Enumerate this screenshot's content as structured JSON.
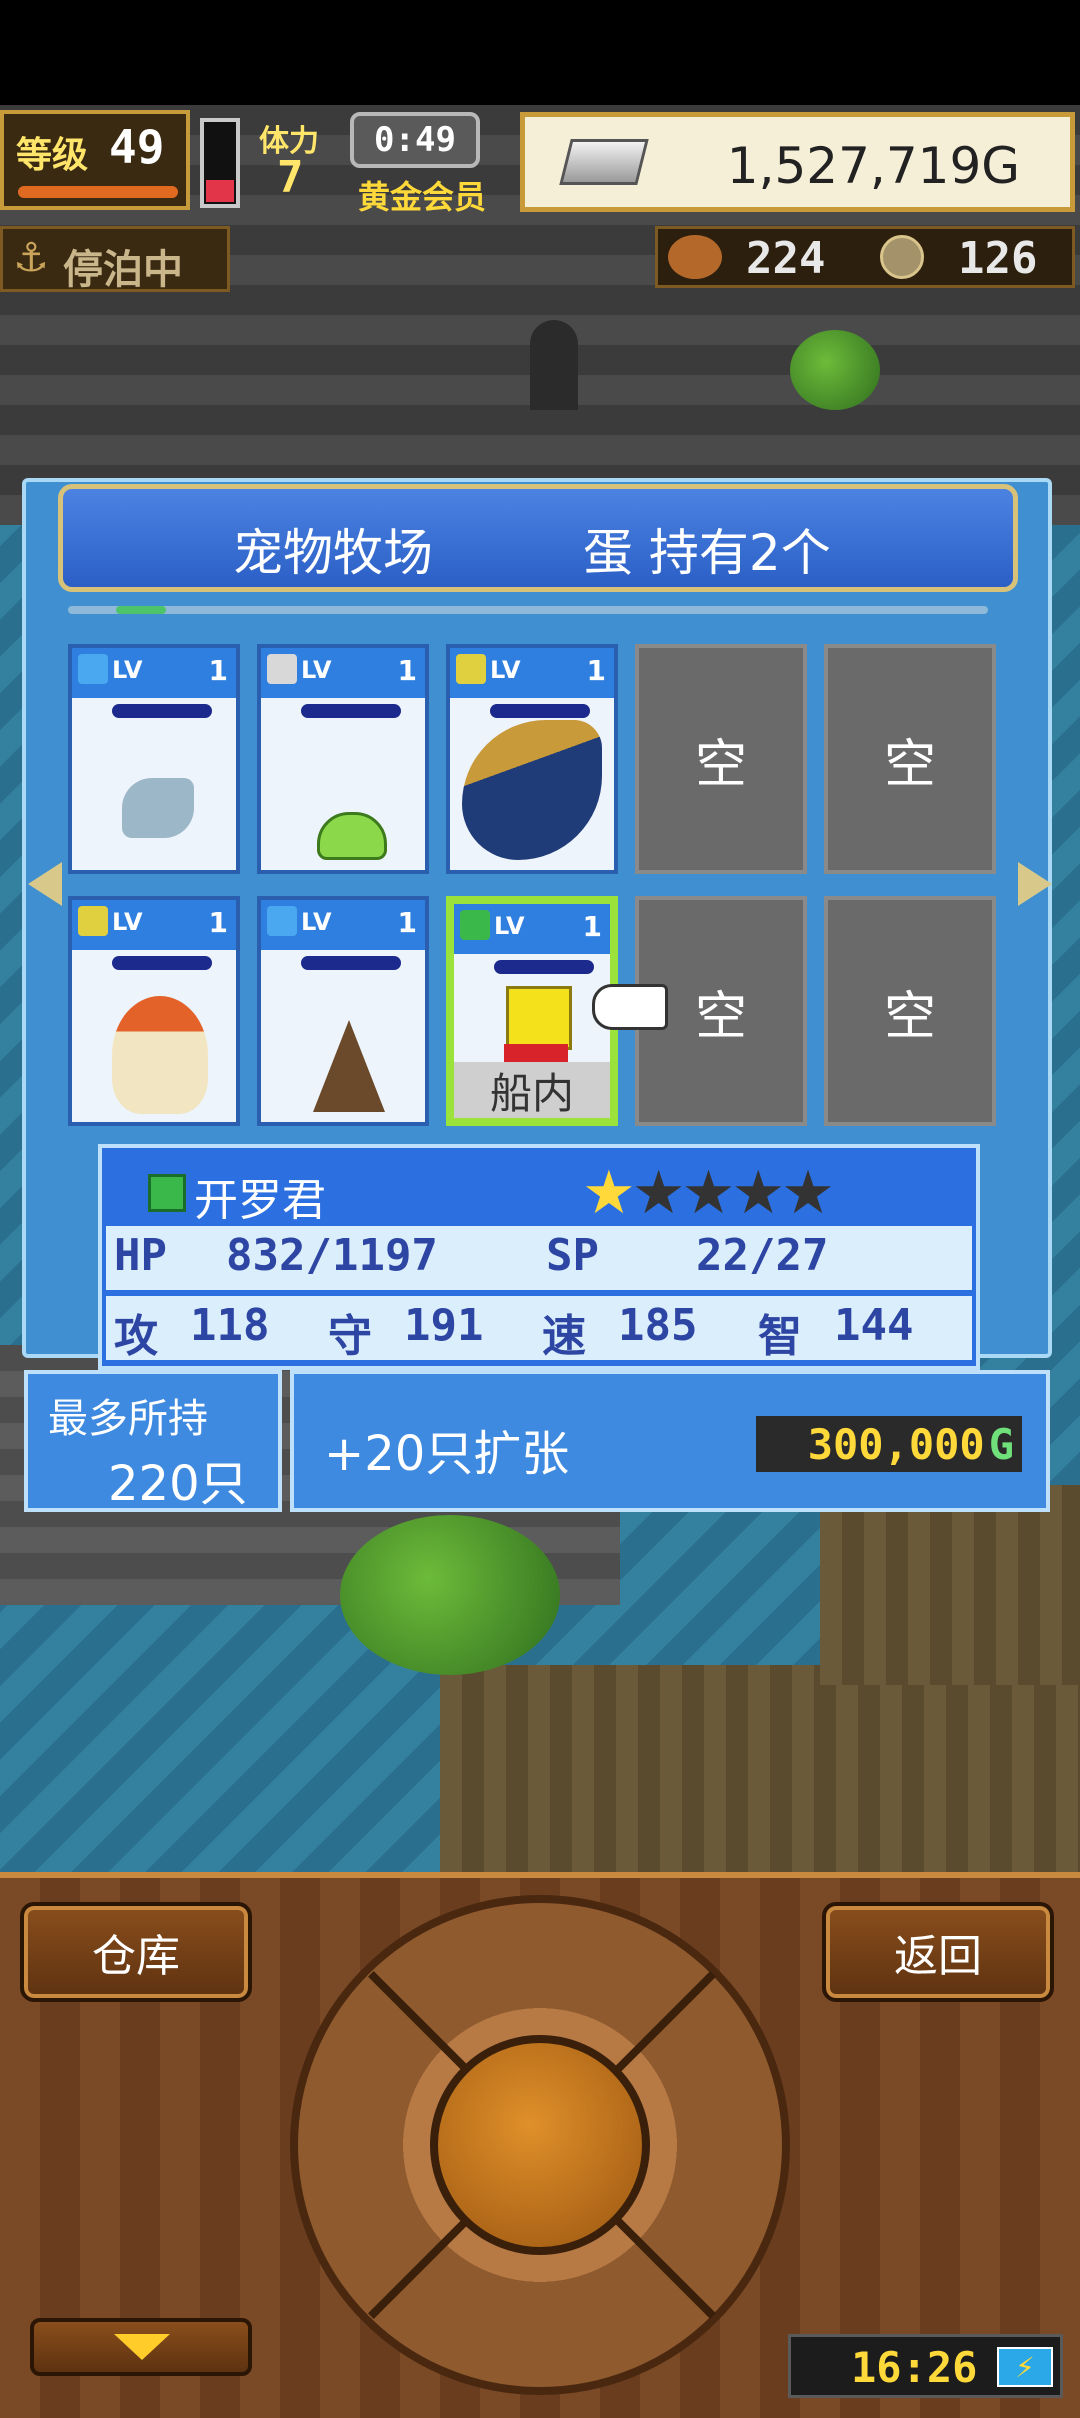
{
  "hud": {
    "level_label": "等级",
    "level": "49",
    "stamina_label": "体力",
    "stamina": "7",
    "timer": "0:49",
    "membership": "黄金会员",
    "gold": "1,527,719G",
    "status": "停泊中",
    "resource1": "224",
    "resource2": "126"
  },
  "panel": {
    "title": "宠物牧场",
    "egg_info": "蛋 持有2个"
  },
  "pets": [
    {
      "lv_label": "LV",
      "level": "1",
      "elem_color": "#4aa8f0",
      "sprite": "fish-creature"
    },
    {
      "lv_label": "LV",
      "level": "1",
      "elem_color": "#d8d8d8",
      "sprite": "green-slime"
    },
    {
      "lv_label": "LV",
      "level": "1",
      "elem_color": "#e0d040",
      "sprite": "winged-serpent"
    },
    {
      "lv_label": "LV",
      "level": "1",
      "elem_color": "#e0d040",
      "sprite": "rooster-bird"
    },
    {
      "lv_label": "LV",
      "level": "1",
      "elem_color": "#4aa8f0",
      "sprite": "hooded-mole"
    },
    {
      "lv_label": "LV",
      "level": "1",
      "elem_color": "#3ab84a",
      "sprite": "yellow-box-kairo",
      "tag": "船内"
    }
  ],
  "empty_label": "空",
  "selected": {
    "name": "开罗君",
    "stars": 1,
    "max_stars": 5,
    "hp_label": "HP",
    "hp": "832/1197",
    "sp_label": "SP",
    "sp": "22/27",
    "atk_label": "攻",
    "atk": "118",
    "def_label": "守",
    "def": "191",
    "spd_label": "速",
    "spd": "185",
    "int_label": "智",
    "int": "144"
  },
  "capacity": {
    "label": "最多所持",
    "value": "220只"
  },
  "expand": {
    "label": "+20只扩张",
    "price": "300,000",
    "currency": "G"
  },
  "buttons": {
    "warehouse": "仓库",
    "back": "返回"
  },
  "clock": "16:26"
}
